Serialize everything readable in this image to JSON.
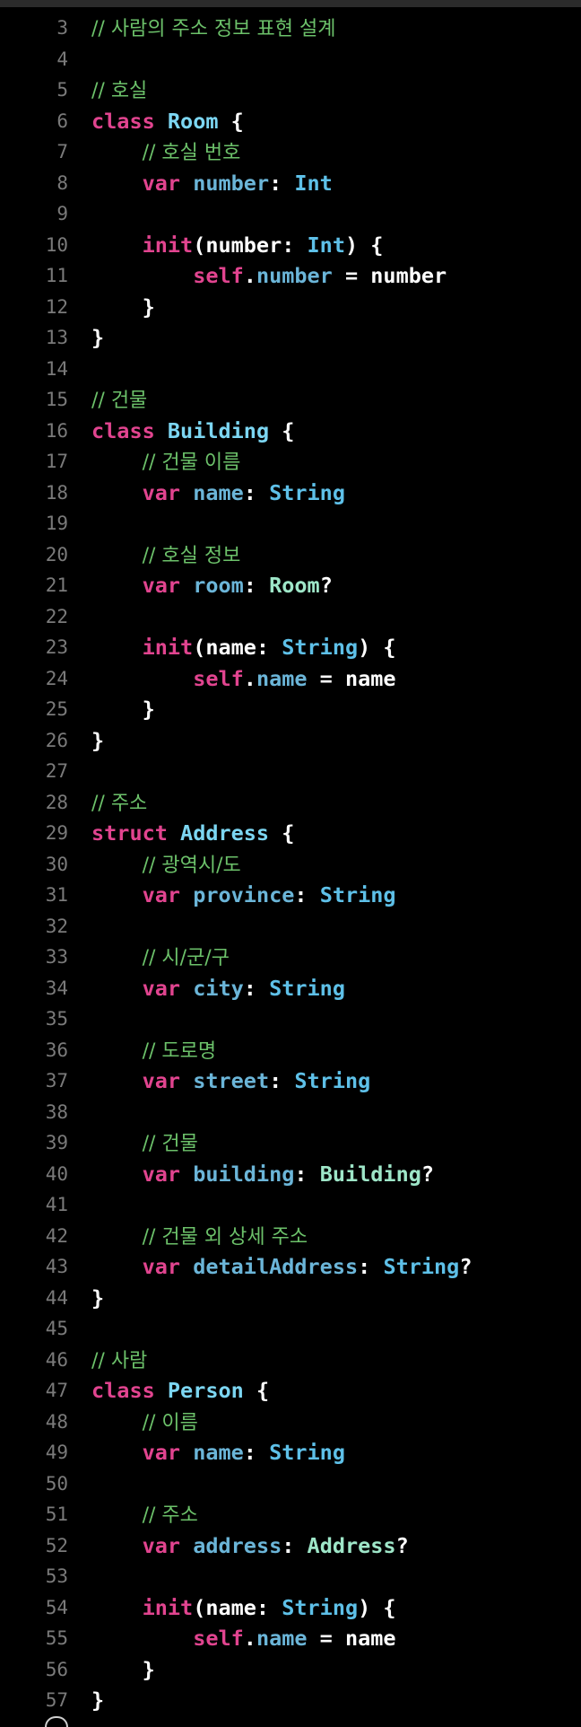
{
  "colors": {
    "background": "#000000",
    "line_number": "#7a7a7a",
    "comment": "#6cc16a",
    "keyword": "#e1448f",
    "type": "#5ec0e8",
    "project_type": "#9ee6c8",
    "declaration": "#7cd6f2",
    "property": "#6bb5d8",
    "text": "#ffffff"
  },
  "lines": [
    {
      "n": "3",
      "tokens": [
        {
          "c": "com",
          "t": "// 사람의 주소 정보 표현 설계"
        }
      ]
    },
    {
      "n": "4",
      "tokens": []
    },
    {
      "n": "5",
      "tokens": [
        {
          "c": "com",
          "t": "// 호실"
        }
      ]
    },
    {
      "n": "6",
      "tokens": [
        {
          "c": "kw",
          "t": "class"
        },
        {
          "c": "txt",
          "t": " "
        },
        {
          "c": "decl",
          "t": "Room"
        },
        {
          "c": "txt",
          "t": " {"
        }
      ]
    },
    {
      "n": "7",
      "tokens": [
        {
          "c": "txt",
          "t": "    "
        },
        {
          "c": "com",
          "t": "// 호실 번호"
        }
      ]
    },
    {
      "n": "8",
      "tokens": [
        {
          "c": "txt",
          "t": "    "
        },
        {
          "c": "kw",
          "t": "var"
        },
        {
          "c": "txt",
          "t": " "
        },
        {
          "c": "prop",
          "t": "number"
        },
        {
          "c": "txt",
          "t": ": "
        },
        {
          "c": "type",
          "t": "Int"
        }
      ]
    },
    {
      "n": "9",
      "tokens": []
    },
    {
      "n": "10",
      "tokens": [
        {
          "c": "txt",
          "t": "    "
        },
        {
          "c": "kw",
          "t": "init"
        },
        {
          "c": "txt",
          "t": "(number: "
        },
        {
          "c": "type",
          "t": "Int"
        },
        {
          "c": "txt",
          "t": ") {"
        }
      ]
    },
    {
      "n": "11",
      "tokens": [
        {
          "c": "txt",
          "t": "        "
        },
        {
          "c": "kw",
          "t": "self"
        },
        {
          "c": "txt",
          "t": "."
        },
        {
          "c": "prop",
          "t": "number"
        },
        {
          "c": "txt",
          "t": " = number"
        }
      ]
    },
    {
      "n": "12",
      "tokens": [
        {
          "c": "txt",
          "t": "    }"
        }
      ]
    },
    {
      "n": "13",
      "tokens": [
        {
          "c": "txt",
          "t": "}"
        }
      ]
    },
    {
      "n": "14",
      "tokens": []
    },
    {
      "n": "15",
      "tokens": [
        {
          "c": "com",
          "t": "// 건물"
        }
      ]
    },
    {
      "n": "16",
      "tokens": [
        {
          "c": "kw",
          "t": "class"
        },
        {
          "c": "txt",
          "t": " "
        },
        {
          "c": "decl",
          "t": "Building"
        },
        {
          "c": "txt",
          "t": " {"
        }
      ]
    },
    {
      "n": "17",
      "tokens": [
        {
          "c": "txt",
          "t": "    "
        },
        {
          "c": "com",
          "t": "// 건물 이름"
        }
      ]
    },
    {
      "n": "18",
      "tokens": [
        {
          "c": "txt",
          "t": "    "
        },
        {
          "c": "kw",
          "t": "var"
        },
        {
          "c": "txt",
          "t": " "
        },
        {
          "c": "prop",
          "t": "name"
        },
        {
          "c": "txt",
          "t": ": "
        },
        {
          "c": "type",
          "t": "String"
        }
      ]
    },
    {
      "n": "19",
      "tokens": []
    },
    {
      "n": "20",
      "tokens": [
        {
          "c": "txt",
          "t": "    "
        },
        {
          "c": "com",
          "t": "// 호실 정보"
        }
      ]
    },
    {
      "n": "21",
      "tokens": [
        {
          "c": "txt",
          "t": "    "
        },
        {
          "c": "kw",
          "t": "var"
        },
        {
          "c": "txt",
          "t": " "
        },
        {
          "c": "prop",
          "t": "room"
        },
        {
          "c": "txt",
          "t": ": "
        },
        {
          "c": "ptype",
          "t": "Room"
        },
        {
          "c": "txt",
          "t": "?"
        }
      ]
    },
    {
      "n": "22",
      "tokens": []
    },
    {
      "n": "23",
      "tokens": [
        {
          "c": "txt",
          "t": "    "
        },
        {
          "c": "kw",
          "t": "init"
        },
        {
          "c": "txt",
          "t": "(name: "
        },
        {
          "c": "type",
          "t": "String"
        },
        {
          "c": "txt",
          "t": ") {"
        }
      ]
    },
    {
      "n": "24",
      "tokens": [
        {
          "c": "txt",
          "t": "        "
        },
        {
          "c": "kw",
          "t": "self"
        },
        {
          "c": "txt",
          "t": "."
        },
        {
          "c": "prop",
          "t": "name"
        },
        {
          "c": "txt",
          "t": " = name"
        }
      ]
    },
    {
      "n": "25",
      "tokens": [
        {
          "c": "txt",
          "t": "    }"
        }
      ]
    },
    {
      "n": "26",
      "tokens": [
        {
          "c": "txt",
          "t": "}"
        }
      ]
    },
    {
      "n": "27",
      "tokens": []
    },
    {
      "n": "28",
      "tokens": [
        {
          "c": "com",
          "t": "// 주소"
        }
      ]
    },
    {
      "n": "29",
      "tokens": [
        {
          "c": "kw",
          "t": "struct"
        },
        {
          "c": "txt",
          "t": " "
        },
        {
          "c": "decl",
          "t": "Address"
        },
        {
          "c": "txt",
          "t": " {"
        }
      ]
    },
    {
      "n": "30",
      "tokens": [
        {
          "c": "txt",
          "t": "    "
        },
        {
          "c": "com",
          "t": "// 광역시/도"
        }
      ]
    },
    {
      "n": "31",
      "tokens": [
        {
          "c": "txt",
          "t": "    "
        },
        {
          "c": "kw",
          "t": "var"
        },
        {
          "c": "txt",
          "t": " "
        },
        {
          "c": "prop",
          "t": "province"
        },
        {
          "c": "txt",
          "t": ": "
        },
        {
          "c": "type",
          "t": "String"
        }
      ]
    },
    {
      "n": "32",
      "tokens": []
    },
    {
      "n": "33",
      "tokens": [
        {
          "c": "txt",
          "t": "    "
        },
        {
          "c": "com",
          "t": "// 시/군/구"
        }
      ]
    },
    {
      "n": "34",
      "tokens": [
        {
          "c": "txt",
          "t": "    "
        },
        {
          "c": "kw",
          "t": "var"
        },
        {
          "c": "txt",
          "t": " "
        },
        {
          "c": "prop",
          "t": "city"
        },
        {
          "c": "txt",
          "t": ": "
        },
        {
          "c": "type",
          "t": "String"
        }
      ]
    },
    {
      "n": "35",
      "tokens": []
    },
    {
      "n": "36",
      "tokens": [
        {
          "c": "txt",
          "t": "    "
        },
        {
          "c": "com",
          "t": "// 도로명"
        }
      ]
    },
    {
      "n": "37",
      "tokens": [
        {
          "c": "txt",
          "t": "    "
        },
        {
          "c": "kw",
          "t": "var"
        },
        {
          "c": "txt",
          "t": " "
        },
        {
          "c": "prop",
          "t": "street"
        },
        {
          "c": "txt",
          "t": ": "
        },
        {
          "c": "type",
          "t": "String"
        }
      ]
    },
    {
      "n": "38",
      "tokens": []
    },
    {
      "n": "39",
      "tokens": [
        {
          "c": "txt",
          "t": "    "
        },
        {
          "c": "com",
          "t": "// 건물"
        }
      ]
    },
    {
      "n": "40",
      "tokens": [
        {
          "c": "txt",
          "t": "    "
        },
        {
          "c": "kw",
          "t": "var"
        },
        {
          "c": "txt",
          "t": " "
        },
        {
          "c": "prop",
          "t": "building"
        },
        {
          "c": "txt",
          "t": ": "
        },
        {
          "c": "ptype",
          "t": "Building"
        },
        {
          "c": "txt",
          "t": "?"
        }
      ]
    },
    {
      "n": "41",
      "tokens": []
    },
    {
      "n": "42",
      "tokens": [
        {
          "c": "txt",
          "t": "    "
        },
        {
          "c": "com",
          "t": "// 건물 외 상세 주소"
        }
      ]
    },
    {
      "n": "43",
      "tokens": [
        {
          "c": "txt",
          "t": "    "
        },
        {
          "c": "kw",
          "t": "var"
        },
        {
          "c": "txt",
          "t": " "
        },
        {
          "c": "prop",
          "t": "detailAddress"
        },
        {
          "c": "txt",
          "t": ": "
        },
        {
          "c": "type",
          "t": "String"
        },
        {
          "c": "txt",
          "t": "?"
        }
      ]
    },
    {
      "n": "44",
      "tokens": [
        {
          "c": "txt",
          "t": "}"
        }
      ]
    },
    {
      "n": "45",
      "tokens": []
    },
    {
      "n": "46",
      "tokens": [
        {
          "c": "com",
          "t": "// 사람"
        }
      ]
    },
    {
      "n": "47",
      "tokens": [
        {
          "c": "kw",
          "t": "class"
        },
        {
          "c": "txt",
          "t": " "
        },
        {
          "c": "decl",
          "t": "Person"
        },
        {
          "c": "txt",
          "t": " {"
        }
      ]
    },
    {
      "n": "48",
      "tokens": [
        {
          "c": "txt",
          "t": "    "
        },
        {
          "c": "com",
          "t": "// 이름"
        }
      ]
    },
    {
      "n": "49",
      "tokens": [
        {
          "c": "txt",
          "t": "    "
        },
        {
          "c": "kw",
          "t": "var"
        },
        {
          "c": "txt",
          "t": " "
        },
        {
          "c": "prop",
          "t": "name"
        },
        {
          "c": "txt",
          "t": ": "
        },
        {
          "c": "type",
          "t": "String"
        }
      ]
    },
    {
      "n": "50",
      "tokens": []
    },
    {
      "n": "51",
      "tokens": [
        {
          "c": "txt",
          "t": "    "
        },
        {
          "c": "com",
          "t": "// 주소"
        }
      ]
    },
    {
      "n": "52",
      "tokens": [
        {
          "c": "txt",
          "t": "    "
        },
        {
          "c": "kw",
          "t": "var"
        },
        {
          "c": "txt",
          "t": " "
        },
        {
          "c": "prop",
          "t": "address"
        },
        {
          "c": "txt",
          "t": ": "
        },
        {
          "c": "ptype",
          "t": "Address"
        },
        {
          "c": "txt",
          "t": "?"
        }
      ]
    },
    {
      "n": "53",
      "tokens": []
    },
    {
      "n": "54",
      "tokens": [
        {
          "c": "txt",
          "t": "    "
        },
        {
          "c": "kw",
          "t": "init"
        },
        {
          "c": "txt",
          "t": "(name: "
        },
        {
          "c": "type",
          "t": "String"
        },
        {
          "c": "txt",
          "t": ") {"
        }
      ]
    },
    {
      "n": "55",
      "tokens": [
        {
          "c": "txt",
          "t": "        "
        },
        {
          "c": "kw",
          "t": "self"
        },
        {
          "c": "txt",
          "t": "."
        },
        {
          "c": "prop",
          "t": "name"
        },
        {
          "c": "txt",
          "t": " = name"
        }
      ]
    },
    {
      "n": "56",
      "tokens": [
        {
          "c": "txt",
          "t": "    }"
        }
      ]
    },
    {
      "n": "57",
      "tokens": [
        {
          "c": "txt",
          "t": "}"
        }
      ]
    }
  ]
}
